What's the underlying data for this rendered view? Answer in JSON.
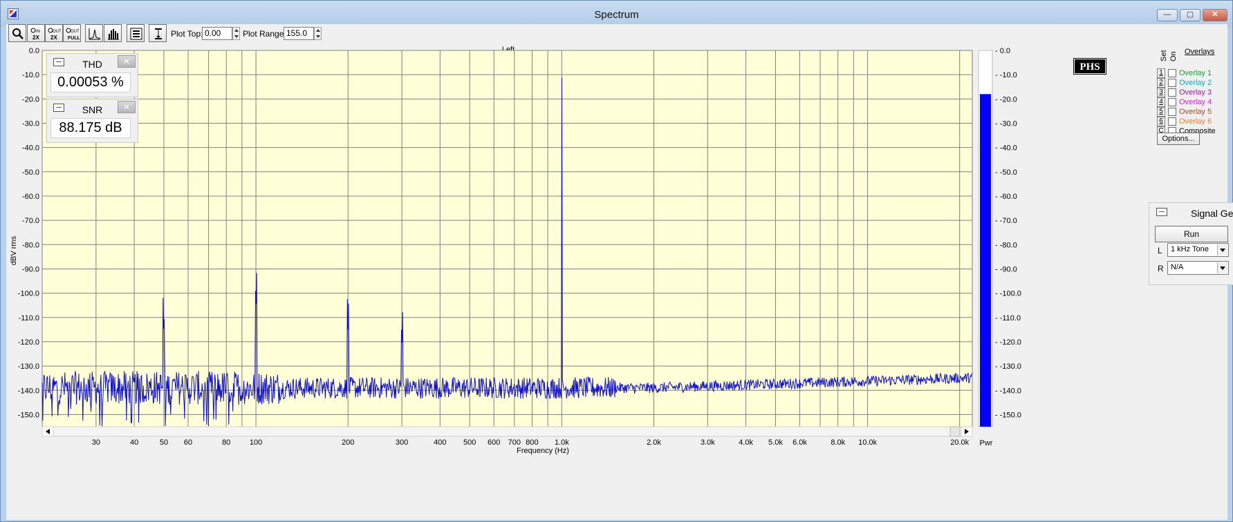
{
  "window": {
    "title": "Spectrum",
    "controls": {
      "minimize": "—",
      "maximize": "▢",
      "close": "✕"
    }
  },
  "toolbar": {
    "buttons": [
      {
        "name": "zoom-button",
        "icon": "magnifier-icon"
      },
      {
        "name": "zoom-in-2x-button",
        "icon": "zoom-in-2x-icon",
        "text": "IN 2X"
      },
      {
        "name": "zoom-out-2x-button",
        "icon": "zoom-out-2x-icon",
        "text": "OUT 2X"
      },
      {
        "name": "zoom-out-full-button",
        "icon": "zoom-out-full-icon",
        "text": "OUT FULL"
      },
      {
        "name": "peak-button",
        "icon": "peak-icon"
      },
      {
        "name": "bars-button",
        "icon": "bars-icon"
      },
      {
        "name": "properties-button",
        "icon": "properties-icon"
      },
      {
        "name": "range-button",
        "icon": "range-icon"
      }
    ],
    "plot_top_label": "Plot Top:",
    "plot_top_value": "0.00",
    "plot_range_label": "Plot Range:",
    "plot_range_value": "155.0"
  },
  "meters": {
    "thd": {
      "title": "THD",
      "value": "0.00053 %"
    },
    "snr": {
      "title": "SNR",
      "value": "88.175 dB"
    }
  },
  "logo": "PHS",
  "overlays": {
    "title": "Overlays",
    "set_header": "Set",
    "on_header": "On",
    "items": [
      {
        "num": "1",
        "label": "Overlay 1",
        "color": "#1a9a3a"
      },
      {
        "num": "2",
        "label": "Overlay 2",
        "color": "#19a9b5"
      },
      {
        "num": "3",
        "label": "Overlay 3",
        "color": "#a020a0"
      },
      {
        "num": "4",
        "label": "Overlay 4",
        "color": "#e020e0"
      },
      {
        "num": "5",
        "label": "Overlay 5",
        "color": "#a05020"
      },
      {
        "num": "6",
        "label": "Overlay 6",
        "color": "#f08030"
      },
      {
        "num": "C",
        "label": "Composite",
        "color": "#000000"
      }
    ],
    "options_label": "Options..."
  },
  "signal_generator": {
    "title": "Signal Gen",
    "run_label": "Run",
    "left_label": "L",
    "left_value": "1 kHz Tone",
    "right_label": "R",
    "right_value": "N/A"
  },
  "chart_data": {
    "type": "line",
    "title": "Left",
    "xlabel": "Frequency (Hz)",
    "ylabel": "dBV rms",
    "xscale": "log",
    "xlim": [
      20,
      22000
    ],
    "ylim": [
      -155,
      0
    ],
    "y_ticks": [
      "0.0",
      "-10.0",
      "-20.0",
      "-30.0",
      "-40.0",
      "-50.0",
      "-60.0",
      "-70.0",
      "-80.0",
      "-90.0",
      "-100.0",
      "-110.0",
      "-120.0",
      "-130.0",
      "-140.0",
      "-150.0"
    ],
    "x_ticks": [
      {
        "value": 30,
        "label": "30"
      },
      {
        "value": 40,
        "label": "40"
      },
      {
        "value": 50,
        "label": "50"
      },
      {
        "value": 60,
        "label": "60"
      },
      {
        "value": 80,
        "label": "80"
      },
      {
        "value": 100,
        "label": "100"
      },
      {
        "value": 200,
        "label": "200"
      },
      {
        "value": 300,
        "label": "300"
      },
      {
        "value": 400,
        "label": "400"
      },
      {
        "value": 500,
        "label": "500"
      },
      {
        "value": 600,
        "label": "600"
      },
      {
        "value": 700,
        "label": "700"
      },
      {
        "value": 800,
        "label": "800"
      },
      {
        "value": 1000,
        "label": "1.0k"
      },
      {
        "value": 2000,
        "label": "2.0k"
      },
      {
        "value": 3000,
        "label": "3.0k"
      },
      {
        "value": 4000,
        "label": "4.0k"
      },
      {
        "value": 5000,
        "label": "5.0k"
      },
      {
        "value": 6000,
        "label": "6.0k"
      },
      {
        "value": 8000,
        "label": "8.0k"
      },
      {
        "value": 10000,
        "label": "10.0k"
      },
      {
        "value": 20000,
        "label": "20.0k"
      }
    ],
    "noise_floor_db": -139,
    "peaks": [
      {
        "x": 50,
        "y": -119
      },
      {
        "x": 100,
        "y": -108
      },
      {
        "x": 200,
        "y": -116
      },
      {
        "x": 300,
        "y": -124
      },
      {
        "x": 1000,
        "y": -18
      }
    ],
    "grid": true,
    "line_color": "#1010d0",
    "background_color": "#ffffd8",
    "power_bar": {
      "label": "Pwr",
      "level_db": -18,
      "color": "#0000ff"
    }
  }
}
